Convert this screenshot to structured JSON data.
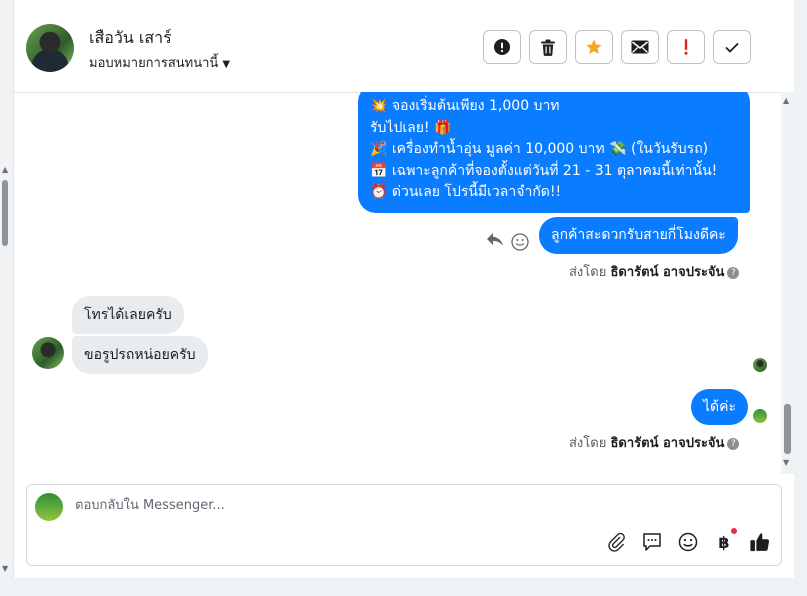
{
  "header": {
    "contact_name": "เสือวัน เสาร์",
    "assign_label": "มอบหมายการสนทนานี้",
    "toolbar": [
      {
        "name": "spam-button",
        "icon": "alert-circle-icon"
      },
      {
        "name": "delete-button",
        "icon": "trash-icon"
      },
      {
        "name": "star-button",
        "icon": "star-icon"
      },
      {
        "name": "mark-unread-button",
        "icon": "envelope-icon"
      },
      {
        "name": "follow-up-button",
        "icon": "exclamation-icon"
      },
      {
        "name": "mark-done-button",
        "icon": "check-icon"
      }
    ]
  },
  "messages": {
    "outgoing_big": [
      "💥 จองเริ่มต้นเพียง 1,000 บาท",
      "รับไปเลย! 🎁",
      "🎉 เครื่องทำน้ำอุ่น มูลค่า 10,000 บาท 💸 (ในวันรับรถ)",
      "📅 เฉพาะลูกค้าที่จองตั้งแต่วันที่ 21 - 31 ตุลาคมนี้เท่านั้น!",
      "⏰ ด่วนเลย โปรนี้มีเวลาจำกัด!!"
    ],
    "outgoing_1": "ลูกค้าสะดวกรับสายกี่โมงดีคะ",
    "sent_by_prefix": "ส่งโดย",
    "sent_by_name": "ธิดารัตน์ อาจประจัน",
    "incoming_1": "โทรได้เลยครับ",
    "incoming_2": "ขอรูปรถหน่อยครับ",
    "outgoing_2": "ได้ค่ะ"
  },
  "composer": {
    "placeholder": "ตอบกลับใน Messenger..."
  },
  "colors": {
    "outgoing_bubble": "#0a7cff",
    "incoming_bubble": "#e9ecef",
    "star": "#f5a623",
    "follow_up": "#e02020",
    "badge_dot": "#f02849"
  }
}
